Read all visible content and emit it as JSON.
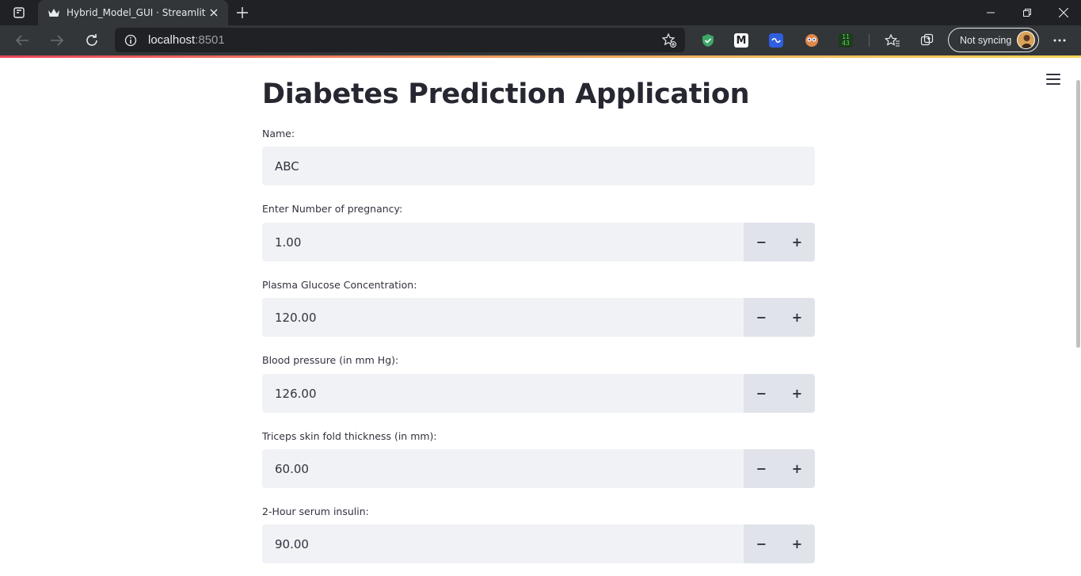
{
  "browser": {
    "tab_title": "Hybrid_Model_GUI · Streamlit",
    "url_host": "localhost",
    "url_port": ":8501",
    "sync_label": "Not syncing",
    "ext_m_label": "M",
    "ext_counter_top": "11",
    "ext_counter_bottom": "43"
  },
  "app": {
    "title": "Diabetes Prediction Application",
    "name_field": {
      "label": "Name:",
      "value": "ABC"
    },
    "number_fields": [
      {
        "label": "Enter Number of pregnancy:",
        "value": "1.00"
      },
      {
        "label": "Plasma Glucose Concentration:",
        "value": "120.00"
      },
      {
        "label": "Blood pressure (in mm Hg):",
        "value": "126.00"
      },
      {
        "label": "Triceps skin fold thickness (in mm):",
        "value": "60.00"
      },
      {
        "label": "2-Hour serum insulin:",
        "value": "90.00"
      }
    ],
    "decrement_symbol": "−",
    "increment_symbol": "+"
  }
}
